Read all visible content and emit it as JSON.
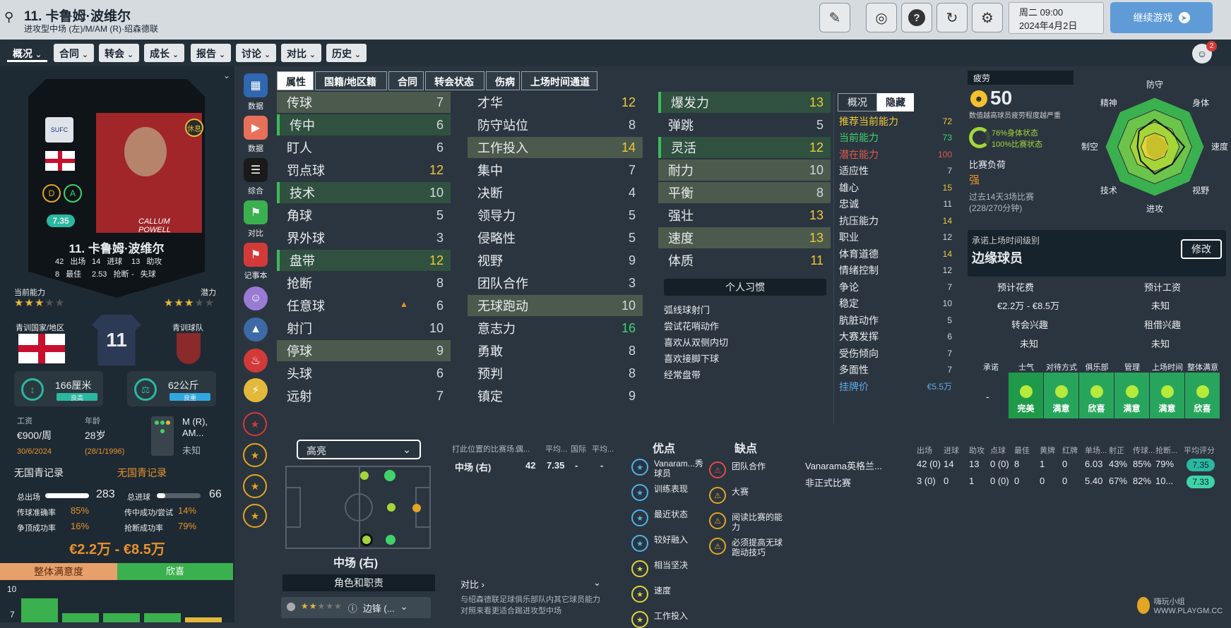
{
  "header": {
    "title": "11. 卡鲁姆·波维尔",
    "subtitle": "进攻型中场 (左)/M/AM (R)·绍森德联",
    "date_line1": "周二 09:00",
    "date_line2": "2024年4月2日",
    "continue": "继续游戏",
    "notification_count": "2"
  },
  "menus": [
    "概况",
    "合同",
    "转会",
    "成长",
    "报告",
    "讨论",
    "对比",
    "历史"
  ],
  "sidebar_left_labels": [
    "数据",
    "数据",
    "综合",
    "对比",
    "记事本"
  ],
  "card": {
    "name": "11. 卡鲁姆·波维尔",
    "rating": "7.35",
    "status": "休息",
    "badges": [
      "D",
      "A"
    ],
    "stats": [
      {
        "v": "42",
        "l": "出场"
      },
      {
        "v": "14",
        "l": "进球"
      },
      {
        "v": "13",
        "l": "助攻"
      },
      {
        "v": "8",
        "l": "最佳"
      },
      {
        "v": "2.53",
        "l": "抢断"
      },
      {
        "v": "-",
        "l": "失球"
      }
    ],
    "jersey": "11",
    "photo_caption": "CALLUM POWELL"
  },
  "ability": {
    "current_label": "当前能力",
    "potential_label": "潜力",
    "current_stars": 3,
    "potential_stars": 3.5,
    "youth_nation_label": "青训国家/地区",
    "youth_club_label": "青训球队"
  },
  "physical": {
    "height": "166厘米",
    "height_tag": "良高",
    "weight": "62公斤",
    "weight_tag": "良重"
  },
  "contract": {
    "wage_label": "工资",
    "wage": "€900/周",
    "expiry": "30/6/2024",
    "age_label": "年龄",
    "age": "28岁",
    "dob": "(28/1/1996)",
    "position": "M (R), AM...",
    "foot": "未知"
  },
  "international": {
    "left": "无国青记录",
    "right": "无国青记录"
  },
  "career": {
    "apps_label": "总出场",
    "apps": "283",
    "goals_label": "总进球",
    "goals": "66",
    "rows": [
      {
        "l": "传球准确率",
        "v": "85%",
        "l2": "传中成功/尝试",
        "v2": "14%"
      },
      {
        "l": "争顶成功率",
        "v": "16%",
        "l2": "抢断成功率",
        "v2": "79%"
      }
    ]
  },
  "value": "€2.2万 - €8.5万",
  "satisfaction": {
    "label": "整体满意度",
    "value": "欣喜",
    "axis": [
      "10",
      "7"
    ],
    "bars": [
      7.6,
      6.2,
      6.2,
      6.2,
      5.8
    ]
  },
  "attr_tabs": [
    "属性",
    "国籍/地区籍",
    "合同",
    "转会状态",
    "伤病",
    "上场时间通道"
  ],
  "attributes_col1": [
    {
      "n": "传球",
      "v": "7",
      "s": "hl"
    },
    {
      "n": "传中",
      "v": "6",
      "s": "hlg"
    },
    {
      "n": "盯人",
      "v": "6",
      "s": ""
    },
    {
      "n": "罚点球",
      "v": "12",
      "s": ""
    },
    {
      "n": "技术",
      "v": "10",
      "s": "hlg"
    },
    {
      "n": "角球",
      "v": "5",
      "s": ""
    },
    {
      "n": "界外球",
      "v": "3",
      "s": ""
    },
    {
      "n": "盘带",
      "v": "12",
      "s": "hlg"
    },
    {
      "n": "抢断",
      "v": "8",
      "s": ""
    },
    {
      "n": "任意球",
      "v": "6",
      "s": ""
    },
    {
      "n": "射门",
      "v": "10",
      "s": ""
    },
    {
      "n": "停球",
      "v": "9",
      "s": "hl"
    },
    {
      "n": "头球",
      "v": "6",
      "s": ""
    },
    {
      "n": "远射",
      "v": "7",
      "s": ""
    }
  ],
  "attributes_col2": [
    {
      "n": "才华",
      "v": "12",
      "s": ""
    },
    {
      "n": "防守站位",
      "v": "8",
      "s": ""
    },
    {
      "n": "工作投入",
      "v": "14",
      "s": "hl"
    },
    {
      "n": "集中",
      "v": "7",
      "s": ""
    },
    {
      "n": "决断",
      "v": "4",
      "s": ""
    },
    {
      "n": "领导力",
      "v": "5",
      "s": ""
    },
    {
      "n": "侵略性",
      "v": "5",
      "s": ""
    },
    {
      "n": "视野",
      "v": "9",
      "s": ""
    },
    {
      "n": "团队合作",
      "v": "3",
      "s": ""
    },
    {
      "n": "无球跑动",
      "v": "10",
      "s": "hl"
    },
    {
      "n": "意志力",
      "v": "16",
      "s": ""
    },
    {
      "n": "勇敢",
      "v": "8",
      "s": ""
    },
    {
      "n": "预判",
      "v": "8",
      "s": ""
    },
    {
      "n": "镇定",
      "v": "9",
      "s": ""
    }
  ],
  "attributes_col3": [
    {
      "n": "爆发力",
      "v": "13",
      "s": "hlg"
    },
    {
      "n": "弹跳",
      "v": "5",
      "s": ""
    },
    {
      "n": "灵活",
      "v": "12",
      "s": "hlg"
    },
    {
      "n": "耐力",
      "v": "10",
      "s": "hl"
    },
    {
      "n": "平衡",
      "v": "8",
      "s": "hl"
    },
    {
      "n": "强壮",
      "v": "13",
      "s": ""
    },
    {
      "n": "速度",
      "v": "13",
      "s": "hl"
    },
    {
      "n": "体质",
      "v": "11",
      "s": ""
    }
  ],
  "habits": {
    "title": "个人习惯",
    "items": [
      "弧线球射门",
      "尝试花哨动作",
      "喜欢从双侧内切",
      "喜欢接脚下球",
      "经常盘带"
    ]
  },
  "hidden": {
    "tabs": [
      "概况",
      "隐藏"
    ],
    "rows": [
      {
        "n": "推荐当前能力",
        "v": "72",
        "c": "#f0c938"
      },
      {
        "n": "当前能力",
        "v": "73",
        "c": "#3fd36a"
      },
      {
        "n": "潜在能力",
        "v": "100",
        "c": "#e0584b"
      },
      {
        "n": "适应性",
        "v": "7"
      },
      {
        "n": "雄心",
        "v": "15"
      },
      {
        "n": "忠诚",
        "v": "11"
      },
      {
        "n": "抗压能力",
        "v": "14"
      },
      {
        "n": "职业",
        "v": "12"
      },
      {
        "n": "体育道德",
        "v": "14"
      },
      {
        "n": "情绪控制",
        "v": "12"
      },
      {
        "n": "争论",
        "v": "7"
      },
      {
        "n": "稳定",
        "v": "10"
      },
      {
        "n": "肮脏动作",
        "v": "5"
      },
      {
        "n": "大赛发挥",
        "v": "6"
      },
      {
        "n": "受伤倾向",
        "v": "7"
      },
      {
        "n": "多面性",
        "v": "7"
      },
      {
        "n": "挂牌价",
        "v": "€5.5万",
        "c": "#5fa9e6"
      }
    ]
  },
  "fatigue": {
    "label": "疲劳",
    "value": "50",
    "note": "数值越高球员疲劳程度越严重",
    "physical": "76%身体状态",
    "match": "100%比赛状态",
    "load_label": "比赛负荷",
    "load": "强",
    "load_note1": "过去14天3场比赛",
    "load_note2": "(228/270分钟)"
  },
  "radar": {
    "labels": [
      "防守",
      "身体",
      "速度",
      "视野",
      "进攻",
      "技术",
      "制空",
      "精神"
    ],
    "values": [
      0.55,
      0.45,
      0.6,
      0.5,
      0.55,
      0.4,
      0.35,
      0.45
    ]
  },
  "playing_time": {
    "label": "承诺上场时间级别",
    "value": "边缘球员",
    "edit": "修改",
    "fee_label": "预计花费",
    "fee": "€2.2万 - €8.5万",
    "wage_label": "预计工资",
    "wage": "未知",
    "transfer_label": "转会兴趣",
    "transfer": "未知",
    "loan_label": "租借兴趣",
    "loan": "未知"
  },
  "morale": {
    "headers": [
      "承诺",
      "士气",
      "对待方式",
      "俱乐部",
      "管理",
      "上场时间",
      "整体满意"
    ],
    "promise": "-",
    "cells": [
      "完美",
      "满意",
      "欣喜",
      "满意",
      "满意",
      "欣喜"
    ]
  },
  "pitch": {
    "dropdown": "高亮",
    "position": "中场 (右)",
    "roles_label": "角色和职责",
    "role": "边锋 (..."
  },
  "position_table": {
    "headers": [
      "打此位置的比赛场...",
      "偶...",
      "平均...",
      "国际",
      "平均..."
    ],
    "row": [
      "中场 (右)",
      "42",
      "7.35",
      "-",
      "-"
    ],
    "compare": "对比",
    "compare_text": "与绍森德联足球俱乐部队内其它球员能力对照来看更适合踢进攻型中场"
  },
  "strengths": {
    "title": "优点",
    "items": [
      "Vanaram...秀球员",
      "训练表现",
      "最近状态",
      "较好融入",
      "相当坚决",
      "速度",
      "工作投入"
    ]
  },
  "weaknesses": {
    "title": "缺点",
    "items": [
      "团队合作",
      "大赛",
      "阅读比赛的能力",
      "必须提高无球跑动技巧"
    ]
  },
  "season": {
    "headers": [
      "出场",
      "进球",
      "助攻",
      "点球",
      "最佳",
      "黄牌",
      "红牌",
      "单场...",
      "射正",
      "传球...",
      "抢断...",
      "平均评分"
    ],
    "rows": [
      {
        "comp": "Vanarama英格兰...",
        "cells": [
          "42 (0)",
          "14",
          "13",
          "0 (0)",
          "8",
          "1",
          "0",
          "6.03",
          "43%",
          "85%",
          "79%"
        ],
        "rating": "7.35"
      },
      {
        "comp": "非正式比赛",
        "cells": [
          "3 (0)",
          "0",
          "1",
          "0 (0)",
          "0",
          "0",
          "0",
          "5.40",
          "67%",
          "82%",
          "10..."
        ],
        "rating": "7.33"
      }
    ]
  },
  "watermark": "嗨玩小组 WWW.PLAYGM.CC"
}
